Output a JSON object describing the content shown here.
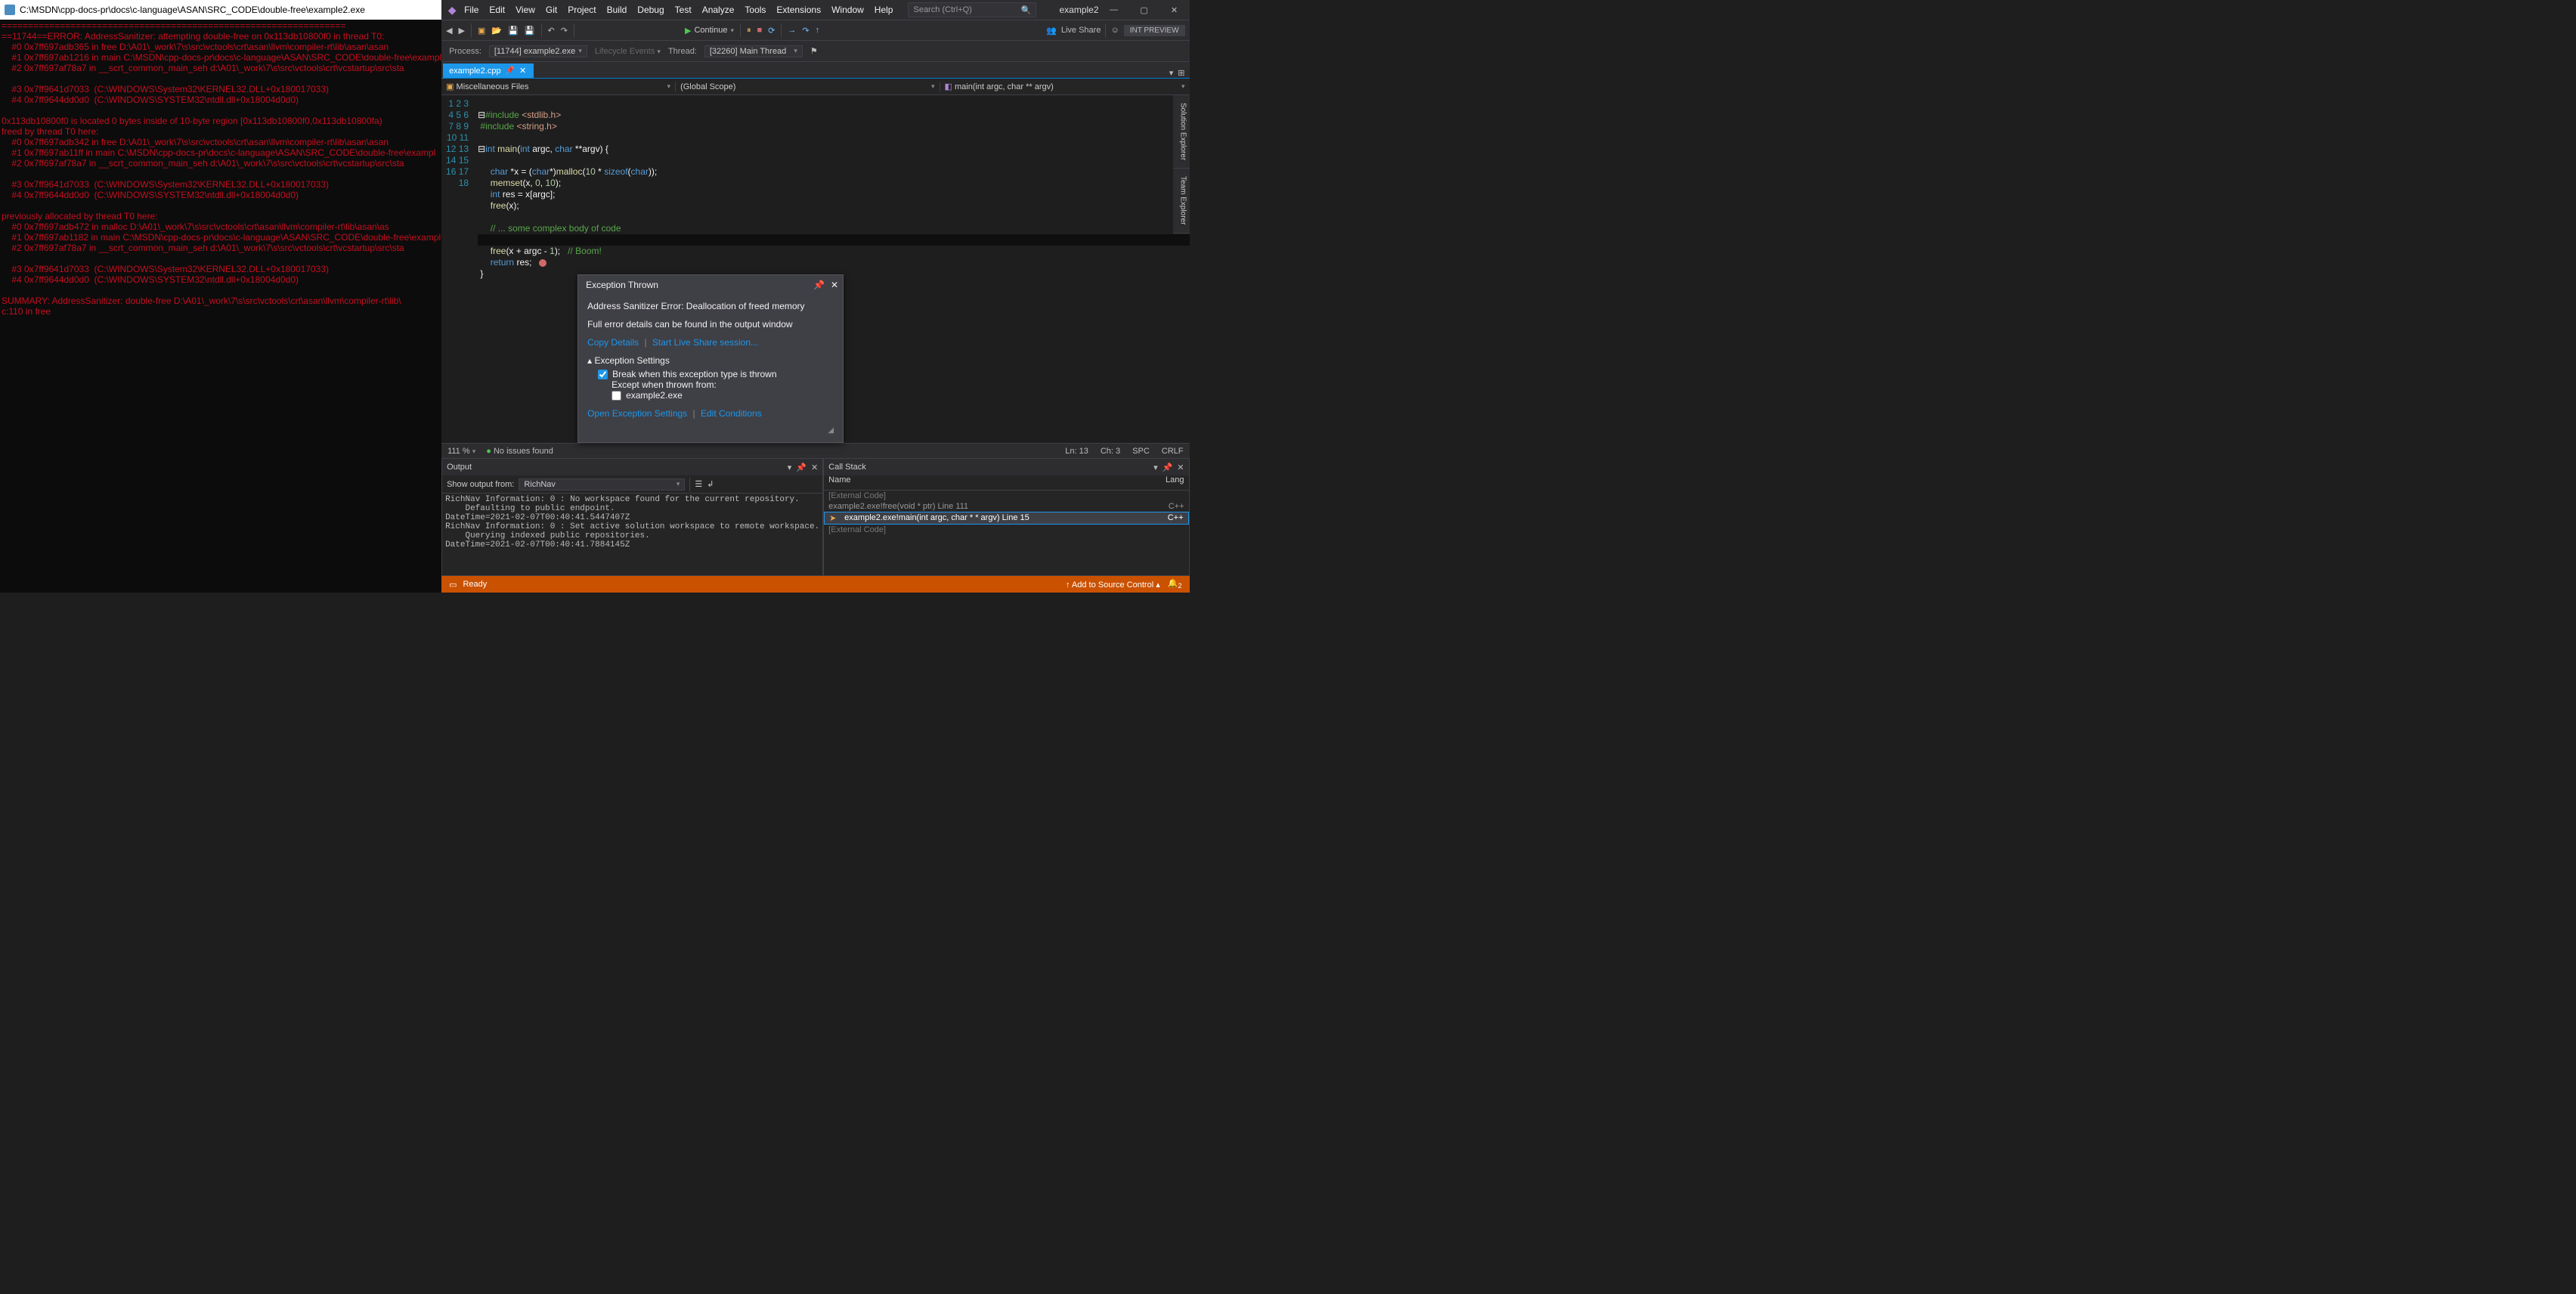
{
  "console": {
    "title": "C:\\MSDN\\cpp-docs-pr\\docs\\c-language\\ASAN\\SRC_CODE\\double-free\\example2.exe",
    "text": "=================================================================\n==11744==ERROR: AddressSanitizer: attempting double-free on 0x113db10800f0 in thread T0:\n    #0 0x7ff697adb365 in free D:\\A01\\_work\\7\\s\\src\\vctools\\crt\\asan\\llvm\\compiler-rt\\lib\\asan\\asan\n    #1 0x7ff697ab1216 in main C:\\MSDN\\cpp-docs-pr\\docs\\c-language\\ASAN\\SRC_CODE\\double-free\\exampl\n    #2 0x7ff697af78a7 in __scrt_common_main_seh d:\\A01\\_work\\7\\s\\src\\vctools\\crt\\vcstartup\\src\\sta\n\n    #3 0x7ff9641d7033  (C:\\WINDOWS\\System32\\KERNEL32.DLL+0x180017033)\n    #4 0x7ff9644dd0d0  (C:\\WINDOWS\\SYSTEM32\\ntdll.dll+0x18004d0d0)\n\n0x113db10800f0 is located 0 bytes inside of 10-byte region [0x113db10800f0,0x113db10800fa)\nfreed by thread T0 here:\n    #0 0x7ff697adb342 in free D:\\A01\\_work\\7\\s\\src\\vctools\\crt\\asan\\llvm\\compiler-rt\\lib\\asan\\asan\n    #1 0x7ff697ab11ff in main C:\\MSDN\\cpp-docs-pr\\docs\\c-language\\ASAN\\SRC_CODE\\double-free\\exampl\n    #2 0x7ff697af78a7 in __scrt_common_main_seh d:\\A01\\_work\\7\\s\\src\\vctools\\crt\\vcstartup\\src\\sta\n\n    #3 0x7ff9641d7033  (C:\\WINDOWS\\System32\\KERNEL32.DLL+0x180017033)\n    #4 0x7ff9644dd0d0  (C:\\WINDOWS\\SYSTEM32\\ntdll.dll+0x18004d0d0)\n\npreviously allocated by thread T0 here:\n    #0 0x7ff697adb472 in malloc D:\\A01\\_work\\7\\s\\src\\vctools\\crt\\asan\\llvm\\compiler-rt\\lib\\asan\\as\n    #1 0x7ff697ab1182 in main C:\\MSDN\\cpp-docs-pr\\docs\\c-language\\ASAN\\SRC_CODE\\double-free\\exampl\n    #2 0x7ff697af78a7 in __scrt_common_main_seh d:\\A01\\_work\\7\\s\\src\\vctools\\crt\\vcstartup\\src\\sta\n\n    #3 0x7ff9641d7033  (C:\\WINDOWS\\System32\\KERNEL32.DLL+0x180017033)\n    #4 0x7ff9644dd0d0  (C:\\WINDOWS\\SYSTEM32\\ntdll.dll+0x18004d0d0)\n\nSUMMARY: AddressSanitizer: double-free D:\\A01\\_work\\7\\s\\src\\vctools\\crt\\asan\\llvm\\compiler-rt\\lib\\\nc:110 in free"
  },
  "vs": {
    "menu": [
      "File",
      "Edit",
      "View",
      "Git",
      "Project",
      "Build",
      "Debug",
      "Test",
      "Analyze",
      "Tools",
      "Extensions",
      "Window",
      "Help"
    ],
    "search_placeholder": "Search (Ctrl+Q)",
    "title": "example2",
    "toolbar": {
      "continue": "Continue",
      "liveshare": "Live Share",
      "intpreview": "INT PREVIEW"
    },
    "debugbar": {
      "process_label": "Process:",
      "process": "[11744] example2.exe",
      "lifecycle": "Lifecycle Events",
      "thread_label": "Thread:",
      "thread": "[32260] Main Thread"
    },
    "tab": {
      "name": "example2.cpp"
    },
    "navbar": {
      "left": "Miscellaneous Files",
      "mid": "(Global Scope)",
      "right": "main(int argc, char ** argv)"
    },
    "sidetabs": [
      "Solution Explorer",
      "Team Explorer"
    ],
    "editor": {
      "lines": 18,
      "zoom": "111 %",
      "issues": "No issues found",
      "pos": {
        "ln": "Ln: 13",
        "ch": "Ch: 3",
        "spc": "SPC",
        "crlf": "CRLF"
      }
    },
    "exception": {
      "title": "Exception Thrown",
      "msg1": "Address Sanitizer Error: Deallocation of freed memory",
      "msg2": "Full error details can be found in the output window",
      "copy": "Copy Details",
      "startlive": "Start Live Share session...",
      "settings_hdr": "Exception Settings",
      "break_label": "Break when this exception type is thrown",
      "except_label": "Except when thrown from:",
      "except_item": "example2.exe",
      "open_settings": "Open Exception Settings",
      "edit_cond": "Edit Conditions"
    },
    "output": {
      "title": "Output",
      "from_label": "Show output from:",
      "from": "RichNav",
      "text": "RichNav Information: 0 : No workspace found for the current repository.\n    Defaulting to public endpoint.\nDateTime=2021-02-07T00:40:41.5447407Z\nRichNav Information: 0 : Set active solution workspace to remote workspace.\n    Querying indexed public repositories.\nDateTime=2021-02-07T00:40:41.7884145Z"
    },
    "callstack": {
      "title": "Call Stack",
      "col_name": "Name",
      "col_lang": "Lang",
      "rows": [
        {
          "name": "[External Code]",
          "lang": ""
        },
        {
          "name": "example2.exe!free(void * ptr) Line 111",
          "lang": "C++"
        },
        {
          "name": "example2.exe!main(int argc, char * * argv) Line 15",
          "lang": "C++",
          "current": true
        },
        {
          "name": "[External Code]",
          "lang": ""
        }
      ]
    },
    "statusbar": {
      "ready": "Ready",
      "add_src": "Add to Source Control",
      "notif": "2"
    }
  }
}
